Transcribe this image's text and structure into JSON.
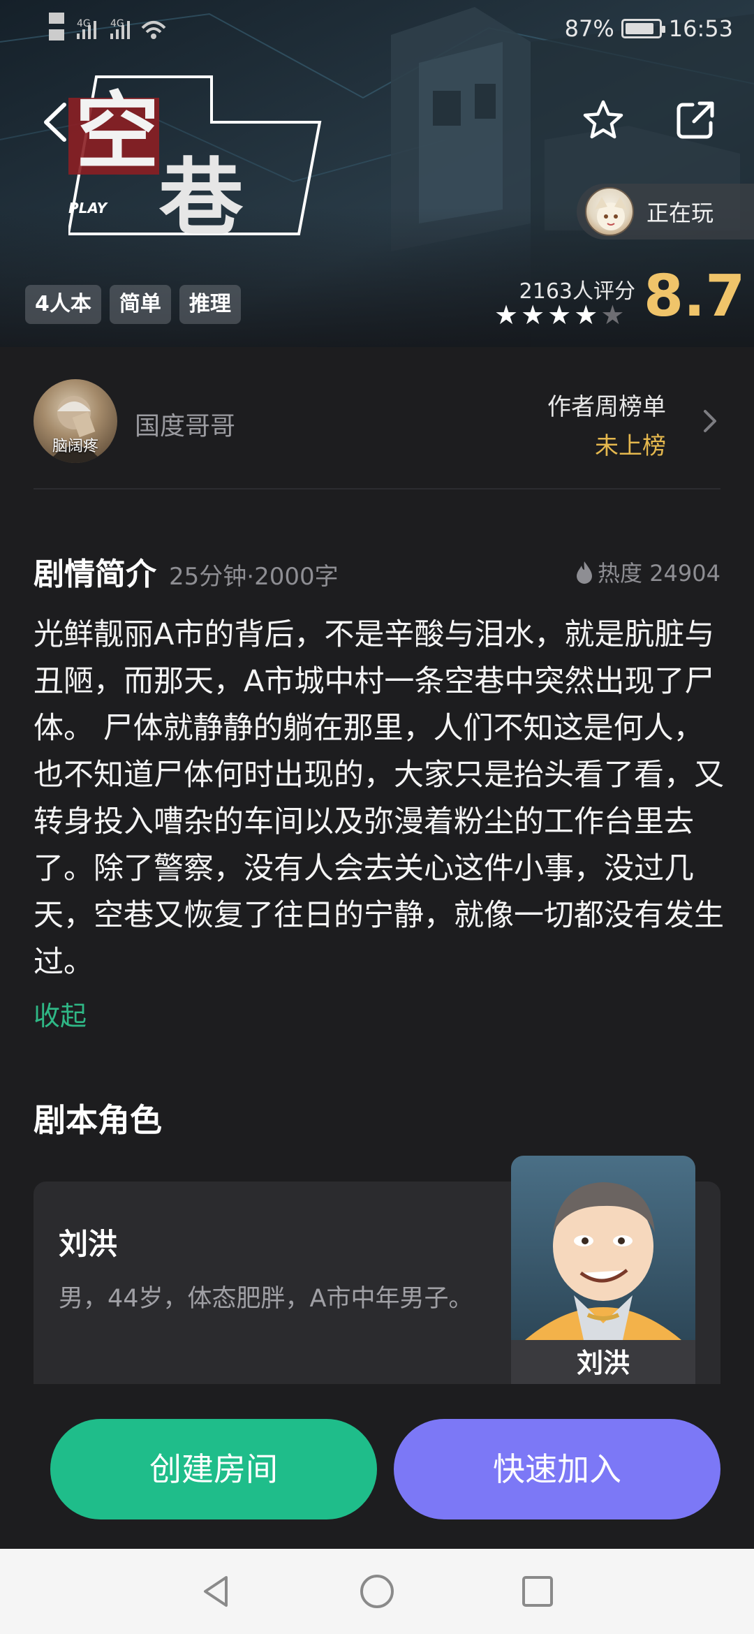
{
  "status_bar": {
    "signal_label_1": "HD",
    "signal_label_2": "4G",
    "battery": "87%",
    "battery_level": 0.87,
    "time": "16:53"
  },
  "hero": {
    "logo_text_1": "空",
    "logo_text_2": "巷",
    "logo_badge": "PLAY",
    "playing_label": "正在玩",
    "tags": [
      "4人本",
      "简单",
      "推理"
    ],
    "rating_count": "2163人评分",
    "stars_filled": 4,
    "stars_total": 5,
    "score": "8.7"
  },
  "author": {
    "avatar_caption": "脑阔疼",
    "name": "国度哥哥",
    "rank_title": "作者周榜单",
    "rank_status": "未上榜"
  },
  "synopsis": {
    "title": "剧情简介",
    "meta": "25分钟·2000字",
    "heat_label": "热度 24904",
    "body": "光鲜靓丽A市的背后，不是辛酸与泪水，就是肮脏与丑陋，而那天，A市城中村一条空巷中突然出现了尸体。 尸体就静静的躺在那里，人们不知这是何人，也不知道尸体何时出现的，大家只是抬头看了看，又转身投入嘈杂的车间以及弥漫着粉尘的工作台里去了。除了警察，没有人会去关心这件小事，没过几天，空巷又恢复了往日的宁静，就像一切都没有发生过。",
    "collapse_label": "收起"
  },
  "roles": {
    "title": "剧本角色",
    "items": [
      {
        "name": "刘洪",
        "desc": "男，44岁，体态肥胖，A市中年男子。",
        "portrait_name": "刘洪"
      }
    ]
  },
  "actions": {
    "create_label": "创建房间",
    "join_label": "快速加入"
  },
  "colors": {
    "accent_green": "#1fbd8a",
    "accent_purple": "#7c78f6",
    "score_gold": "#f0c46a",
    "rank_gold": "#e5b84e"
  }
}
